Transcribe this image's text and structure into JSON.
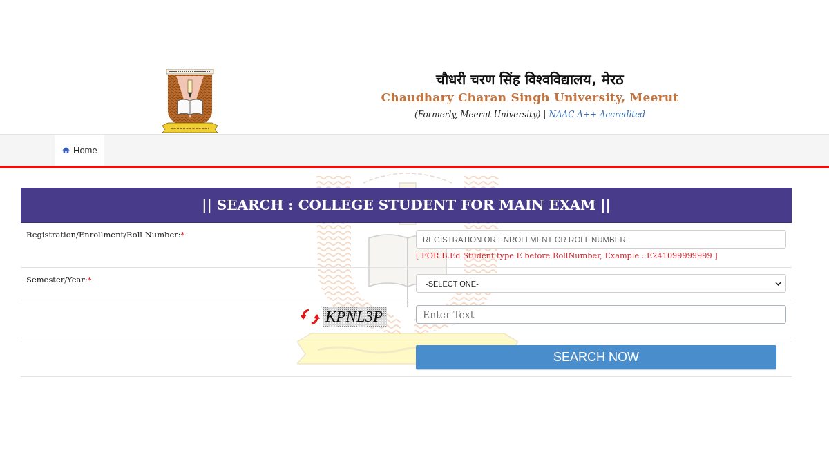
{
  "header": {
    "title_hindi": "चौधरी चरण सिंह विश्वविद्यालय, मेरठ",
    "title": "Chaudhary Charan Singh University, Meerut",
    "subtitle": "(Formerly, Meerut University)",
    "separator": "|",
    "accreditation": "NAAC A++ Accredited"
  },
  "nav": {
    "items": [
      {
        "label": "Home"
      }
    ]
  },
  "form": {
    "title": "|| SEARCH : COLLEGE STUDENT FOR MAIN EXAM ||",
    "rows": [
      {
        "kind": "text",
        "label": "Registration/Enrollment/Roll Number:",
        "required_mark": "*",
        "placeholder": "REGISTRATION OR ENROLLMENT OR ROLL NUMBER",
        "hint": "[ FOR B.Ed Student type E before RollNumber, Example : E241099999999 ]"
      },
      {
        "kind": "select",
        "label": "Semester/Year:",
        "required_mark": "*",
        "value": "-SELECT ONE-"
      },
      {
        "kind": "captcha",
        "captcha": "KPNL3P",
        "placeholder": "Enter Text"
      },
      {
        "kind": "button",
        "button": "SEARCH NOW"
      }
    ]
  }
}
